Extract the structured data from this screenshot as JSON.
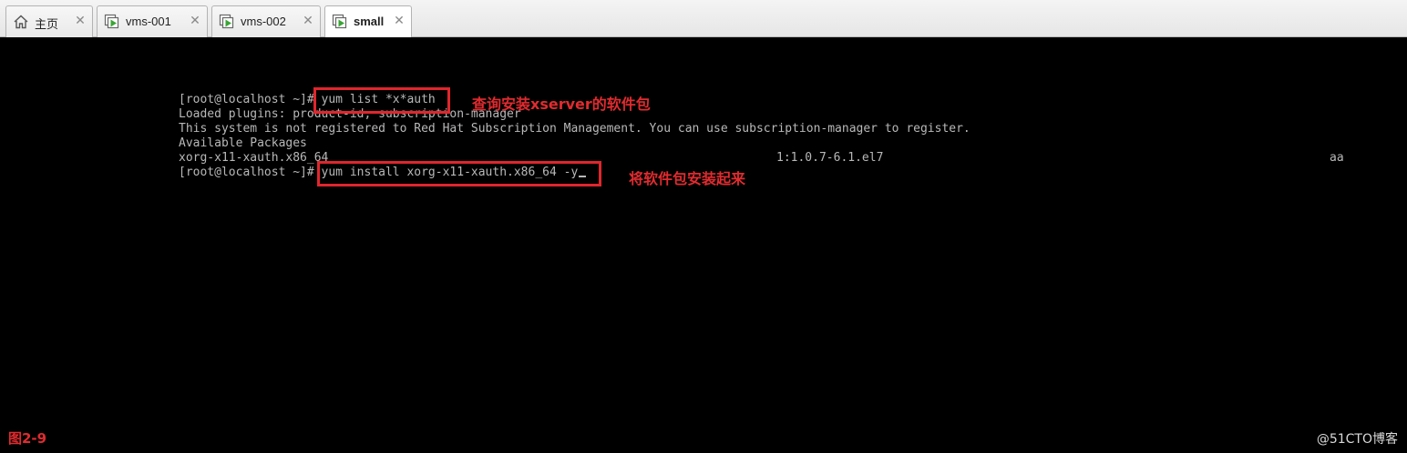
{
  "tabs": [
    {
      "label": "主页",
      "icon": "home-icon",
      "close": "✕"
    },
    {
      "label": "vms-001",
      "icon": "vm-play-icon",
      "close": "✕"
    },
    {
      "label": "vms-002",
      "icon": "vm-play-icon",
      "close": "✕"
    },
    {
      "label": "small",
      "icon": "vm-play-icon",
      "close": "✕",
      "active": true
    }
  ],
  "console": {
    "lines": [
      "[root@localhost ~]# yum list *x*auth",
      "Loaded plugins: product-id, subscription-manager",
      "This system is not registered to Red Hat Subscription Management. You can use subscription-manager to register.",
      "Available Packages"
    ],
    "package_row": {
      "name": "xorg-x11-xauth.x86_64",
      "version": "1:1.0.7-6.1.el7",
      "repo": "aa"
    },
    "last_line": "[root@localhost ~]# yum install xorg-x11-xauth.x86_64 -y"
  },
  "annotations": {
    "first": "查询安装xserver的软件包",
    "second": "将软件包安装起来"
  },
  "figure_label": "图2-9",
  "watermark": "@51CTO博客",
  "colors": {
    "annotation_red": "#e0262d",
    "console_text": "#b8b8b8",
    "console_bg": "#000000"
  }
}
